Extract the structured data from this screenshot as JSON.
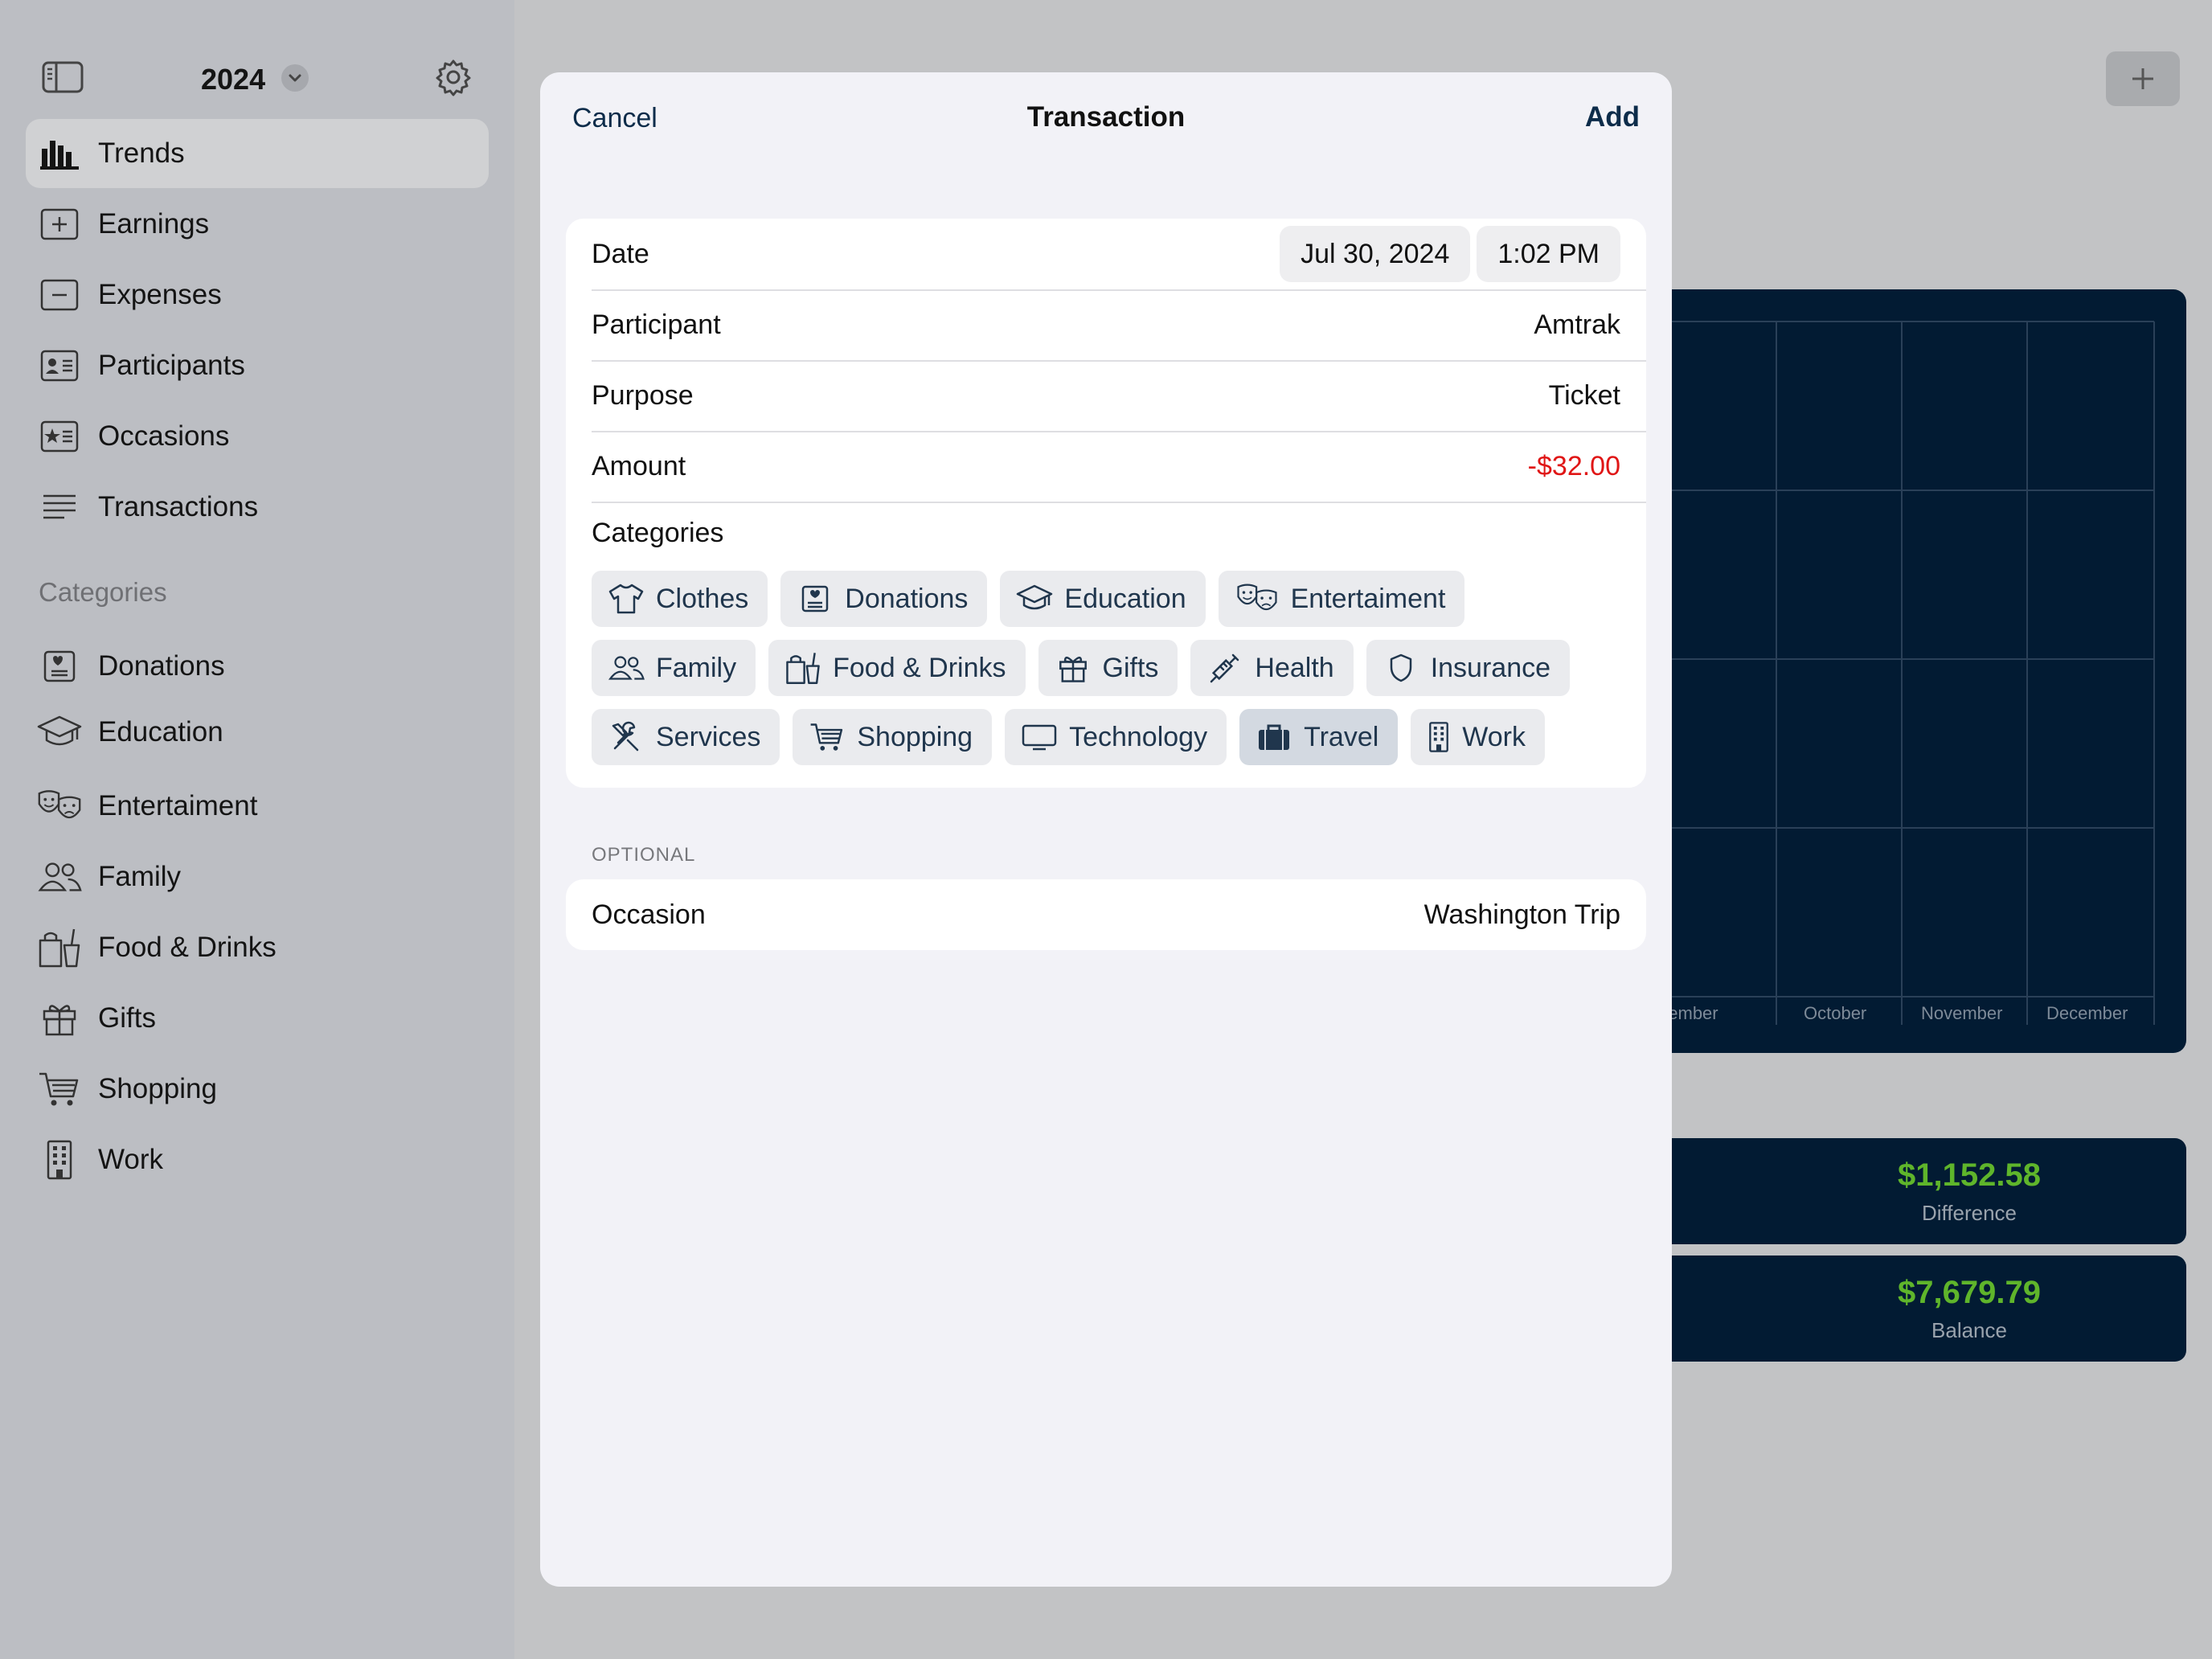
{
  "sidebar": {
    "year": "2024",
    "items": [
      {
        "label": "Trends",
        "icon": "chart-bar-icon",
        "active": true
      },
      {
        "label": "Earnings",
        "icon": "plus-square-icon"
      },
      {
        "label": "Expenses",
        "icon": "minus-square-icon"
      },
      {
        "label": "Participants",
        "icon": "person-card-icon"
      },
      {
        "label": "Occasions",
        "icon": "star-card-icon"
      },
      {
        "label": "Transactions",
        "icon": "list-lines-icon"
      }
    ],
    "categories_title": "Categories",
    "categories": [
      {
        "label": "Donations",
        "icon": "donation-icon"
      },
      {
        "label": "Education",
        "icon": "graduation-cap-icon"
      },
      {
        "label": "Entertaiment",
        "icon": "theater-masks-icon"
      },
      {
        "label": "Family",
        "icon": "people-icon"
      },
      {
        "label": "Food & Drinks",
        "icon": "takeout-bag-icon"
      },
      {
        "label": "Gifts",
        "icon": "gift-icon"
      },
      {
        "label": "Shopping",
        "icon": "cart-icon"
      },
      {
        "label": "Work",
        "icon": "building-icon"
      }
    ]
  },
  "background": {
    "chart_months": [
      "September",
      "October",
      "November",
      "December"
    ],
    "difference_value": "$1,152.58",
    "difference_label": "Difference",
    "balance_value": "$7,679.79",
    "balance_label": "Balance"
  },
  "sheet": {
    "cancel": "Cancel",
    "title": "Transaction",
    "add": "Add",
    "date_label": "Date",
    "date_value": "Jul 30, 2024",
    "time_value": "1:02 PM",
    "participant_label": "Participant",
    "participant_value": "Amtrak",
    "purpose_label": "Purpose",
    "purpose_value": "Ticket",
    "amount_label": "Amount",
    "amount_value": "-$32.00",
    "categories_label": "Categories",
    "chips": [
      [
        {
          "label": "Clothes",
          "icon": "tshirt-icon"
        },
        {
          "label": "Donations",
          "icon": "donation-icon"
        },
        {
          "label": "Education",
          "icon": "graduation-cap-icon"
        },
        {
          "label": "Entertaiment",
          "icon": "theater-masks-icon"
        }
      ],
      [
        {
          "label": "Family",
          "icon": "people-icon"
        },
        {
          "label": "Food & Drinks",
          "icon": "takeout-bag-icon"
        },
        {
          "label": "Gifts",
          "icon": "gift-icon"
        },
        {
          "label": "Health",
          "icon": "syringe-icon"
        },
        {
          "label": "Insurance",
          "icon": "shield-icon"
        }
      ],
      [
        {
          "label": "Services",
          "icon": "tools-icon"
        },
        {
          "label": "Shopping",
          "icon": "cart-icon"
        },
        {
          "label": "Technology",
          "icon": "display-icon"
        },
        {
          "label": "Travel",
          "icon": "suitcase-icon",
          "selected": true
        },
        {
          "label": "Work",
          "icon": "building-icon"
        }
      ]
    ],
    "optional_header": "OPTIONAL",
    "occasion_label": "Occasion",
    "occasion_value": "Washington Trip"
  },
  "colors": {
    "accent": "#0d2c4a",
    "negative": "#e01616",
    "positive": "#5fb52b",
    "dark_card": "#021b33"
  }
}
